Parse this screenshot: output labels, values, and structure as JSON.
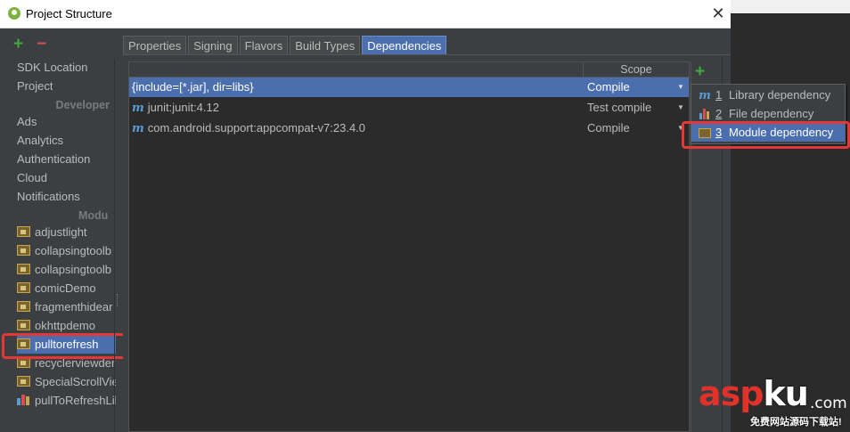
{
  "window": {
    "title": "Project Structure",
    "close_glyph": "✕"
  },
  "left": {
    "add_glyph": "+",
    "remove_glyph": "−",
    "top_items": [
      "SDK Location",
      "Project"
    ],
    "developer_header": "Developer",
    "developer_items": [
      "Ads",
      "Analytics",
      "Authentication",
      "Cloud",
      "Notifications"
    ],
    "modules_header": "Modu",
    "modules": [
      {
        "label": "adjustlight",
        "icon": "module-folder-icon"
      },
      {
        "label": "collapsingtoolb",
        "icon": "module-folder-icon"
      },
      {
        "label": "collapsingtoolb",
        "icon": "module-folder-icon"
      },
      {
        "label": "comicDemo",
        "icon": "module-folder-icon"
      },
      {
        "label": "fragmenthidear",
        "icon": "module-folder-icon"
      },
      {
        "label": "okhttpdemo",
        "icon": "module-folder-icon"
      },
      {
        "label": "pulltorefresh",
        "icon": "module-folder-icon",
        "selected": true
      },
      {
        "label": "recyclerviewder",
        "icon": "module-folder-icon"
      },
      {
        "label": "SpecialScrollVie",
        "icon": "module-folder-icon"
      },
      {
        "label": "pullToRefreshLil",
        "icon": "library-module-icon"
      }
    ]
  },
  "tabs": [
    {
      "label": "Properties"
    },
    {
      "label": "Signing"
    },
    {
      "label": "Flavors"
    },
    {
      "label": "Build Types"
    },
    {
      "label": "Dependencies",
      "active": true
    }
  ],
  "table": {
    "scope_header": "Scope",
    "rows": [
      {
        "name": "{include=[*.jar], dir=libs}",
        "scope": "Compile",
        "icon": "",
        "selected": true
      },
      {
        "name": "junit:junit:4.12",
        "scope": "Test compile",
        "icon": "maven-m-icon",
        "selected": false
      },
      {
        "name": "com.android.support:appcompat-v7:23.4.0",
        "scope": "Compile",
        "icon": "maven-m-icon",
        "selected": false
      }
    ]
  },
  "add_dependency_glyph": "+",
  "menu": {
    "items": [
      {
        "num": "1",
        "label": "Library dependency",
        "icon": "maven-m-icon"
      },
      {
        "num": "2",
        "label": "File dependency",
        "icon": "file-bars-icon"
      },
      {
        "num": "3",
        "label": "Module dependency",
        "icon": "module-folder-icon",
        "selected": true
      }
    ]
  },
  "watermark": {
    "asp": "asp",
    "ku": "ku",
    "com": ".com",
    "sub": "免费网站源码下载站!"
  },
  "colors": {
    "selection": "#4b6eaf",
    "highlight_box": "#e43737",
    "add_green": "#3daa3d",
    "remove_red": "#d64f4f"
  }
}
